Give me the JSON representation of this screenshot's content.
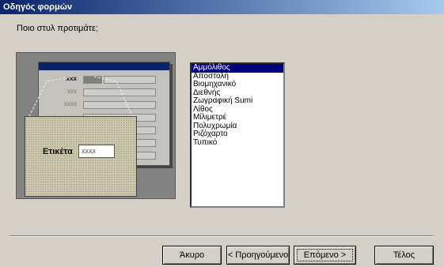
{
  "window": {
    "title": "Οδηγός φορμών"
  },
  "question": "Ποιο στυλ προτιμάτε;",
  "preview": {
    "row_labels": [
      "xxx",
      "xxx",
      "xxxx"
    ],
    "zoom_label": "Ετικέτα",
    "zoom_value": "xxxx"
  },
  "styles": {
    "items": [
      "Αμμόλιθος",
      "Αποστολή",
      "Βιομηχανικό",
      "Διεθνής",
      "Ζωγραφική Sumi",
      "Λίθος",
      "Μίλιμετρέ",
      "Πολυχρωμία",
      "Ριζόχαρτο",
      "Τυπικό"
    ],
    "selected": "Αμμόλιθος"
  },
  "buttons": {
    "cancel": "Άκυρο",
    "back": "< Προηγούμενο",
    "next": "Επόμενο >",
    "finish": "Τέλος"
  },
  "colors": {
    "title_start": "#0a246a",
    "title_end": "#a6caf0",
    "selection": "#000080",
    "dialog_bg": "#d4d0c8"
  }
}
